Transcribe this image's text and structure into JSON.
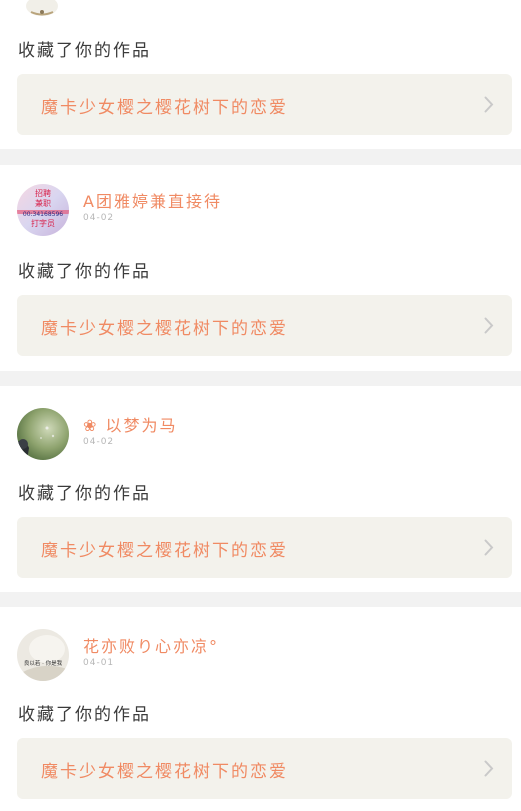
{
  "feed": {
    "top_item": {
      "action": "收藏了你的作品",
      "work_title": "魔卡少女樱之樱花树下的恋爱"
    },
    "items": [
      {
        "username": "A团雅婷兼直接待",
        "date": "04-02",
        "avatar_text_lines": [
          "招聘",
          "兼职",
          "00:34168596",
          "打字员"
        ],
        "action": "收藏了你的作品",
        "work_title": "魔卡少女樱之樱花树下的恋爱"
      },
      {
        "username": "❀ 以梦为马",
        "date": "04-02",
        "action": "收藏了你的作品",
        "work_title": "魔卡少女樱之樱花树下的恋爱"
      },
      {
        "username": "花亦败り心亦凉°",
        "date": "04-01",
        "avatar_text": "良以若 · 你是我",
        "action": "收藏了你的作品",
        "work_title": "魔卡少女樱之樱花树下的恋爱"
      }
    ]
  },
  "colors": {
    "accent": "#f08a63",
    "indicator": "#f07aa8",
    "box_bg": "#f3f2ec",
    "divider_bg": "#f2f2f2"
  },
  "icons": {
    "row_arrow": "chevron-right-icon"
  }
}
